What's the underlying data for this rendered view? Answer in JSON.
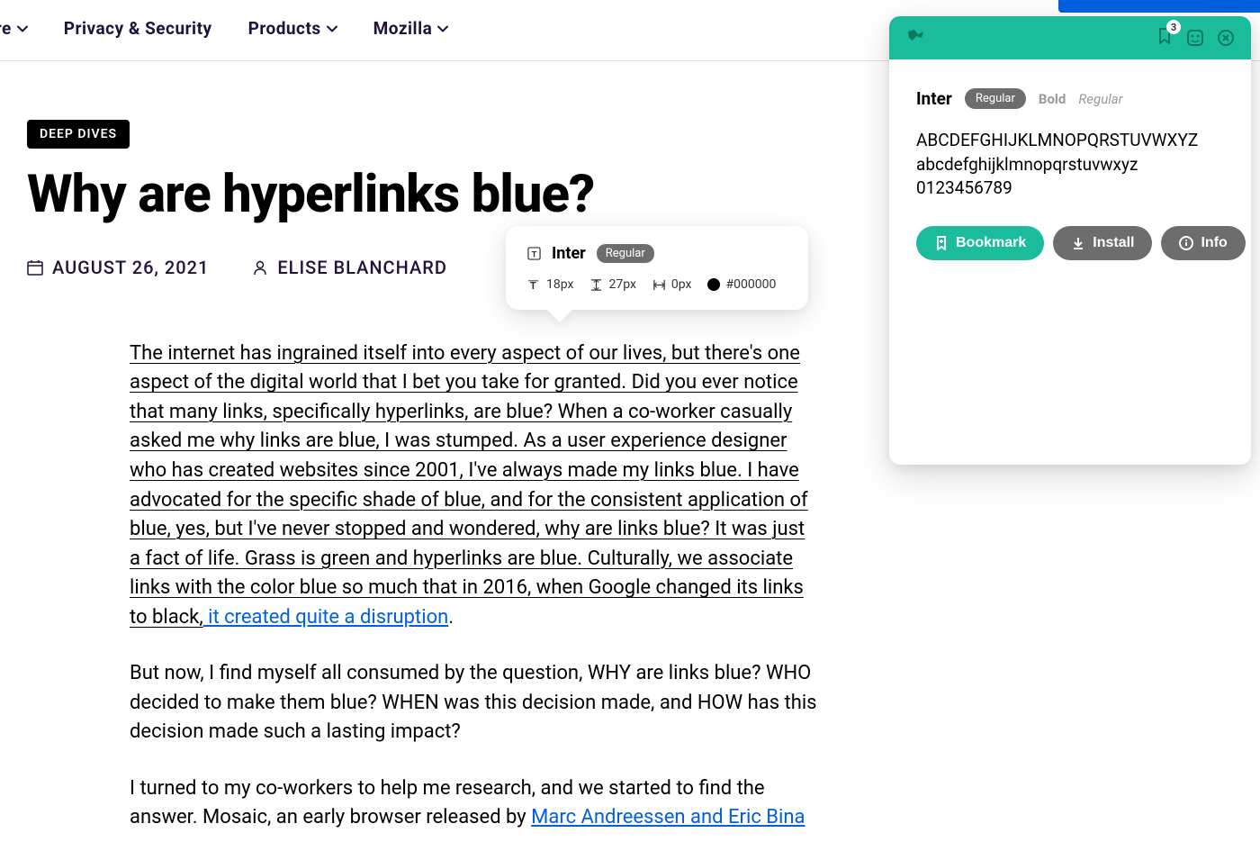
{
  "nav": {
    "items": [
      {
        "label": "ulture",
        "has_chevron": true
      },
      {
        "label": "Privacy & Security",
        "has_chevron": false
      },
      {
        "label": "Products",
        "has_chevron": true
      },
      {
        "label": "Mozilla",
        "has_chevron": true
      }
    ]
  },
  "article": {
    "tag": "DEEP DIVES",
    "title": "Why are hyperlinks blue?",
    "date": "AUGUST 26, 2021",
    "author": "ELISE BLANCHARD",
    "paragraph1_part1": "The internet has ingrained itself into every aspect of our lives, but there's one aspect of the digital world that I bet you take for granted. Did you ever notice that many links, specifically hyperlinks, are blue? When a co-worker casually asked me why links are blue, I was stumped. As a user experience designer who has created websites since 2001, I've always made my links blue. I have advocated for the specific shade of blue, and for the consistent application of blue, yes, but I've never stopped and wondered, why are links blue? It was just a fact of life. Grass is green and hyperlinks are blue. Culturally, we associate links with the color blue so much that in 2016, when Google changed its links to black,",
    "paragraph1_link": " it created quite a disruption",
    "paragraph1_end": ".",
    "paragraph2": "But now, I find myself all consumed by the question, WHY are links blue? WHO decided to make them blue? WHEN was this decision made, and HOW has this decision made such a lasting impact?",
    "paragraph3_part1": "I turned to my co-workers to help me research, and we started to find the answer. Mosaic, an early browser released by ",
    "paragraph3_link": "Marc Andreessen and Eric Bina"
  },
  "tooltip": {
    "font_name": "Inter",
    "style_badge": "Regular",
    "font_size": "18px",
    "line_height": "27px",
    "letter_spacing": "0px",
    "color_hex": "#000000"
  },
  "extension": {
    "bookmark_count": "3",
    "font_name": "Inter",
    "style_active": "Regular",
    "style_bold": "Bold",
    "style_italic": "Regular",
    "sample_upper": "ABCDEFGHIJKLMNOPQRSTUVWXYZ",
    "sample_lower": "abcdefghijklmnopqrstuvwxyz",
    "sample_numbers": "0123456789",
    "buttons": {
      "bookmark": "Bookmark",
      "install": "Install",
      "info": "Info"
    }
  }
}
